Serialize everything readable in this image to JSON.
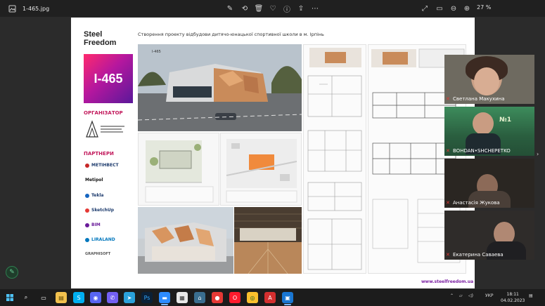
{
  "viewer": {
    "file_name": "1-465.jpg",
    "zoom": "27 %"
  },
  "sheet": {
    "brand_line1": "Steel",
    "brand_line2": "Freedom",
    "title": "Створення проекту відбудови дитячо-юнацької спортивної школи в м. Ірпінь",
    "code": "I-465",
    "organizer_heading": "ОРГАНІЗАТОР",
    "partners_heading": "ПАРТНЕРИ",
    "partners": [
      "МЕТІНВЕСТ",
      "Metipol",
      "Tekla",
      "SketchUp",
      "BIM",
      "LIRALAND",
      "GRAPHISOFT"
    ],
    "render_label": "I-465",
    "website": "www.steelfreedom.ua"
  },
  "participants": [
    {
      "name": "Светлана Макухина"
    },
    {
      "name": "BOHDAN•SHCHEPETKO"
    },
    {
      "name": "Анастасія Жукова"
    },
    {
      "name": "Екатерина Саваева"
    }
  ],
  "taskbar": {
    "language": "УКР",
    "time": "18:11",
    "date": "04.02.2023"
  }
}
